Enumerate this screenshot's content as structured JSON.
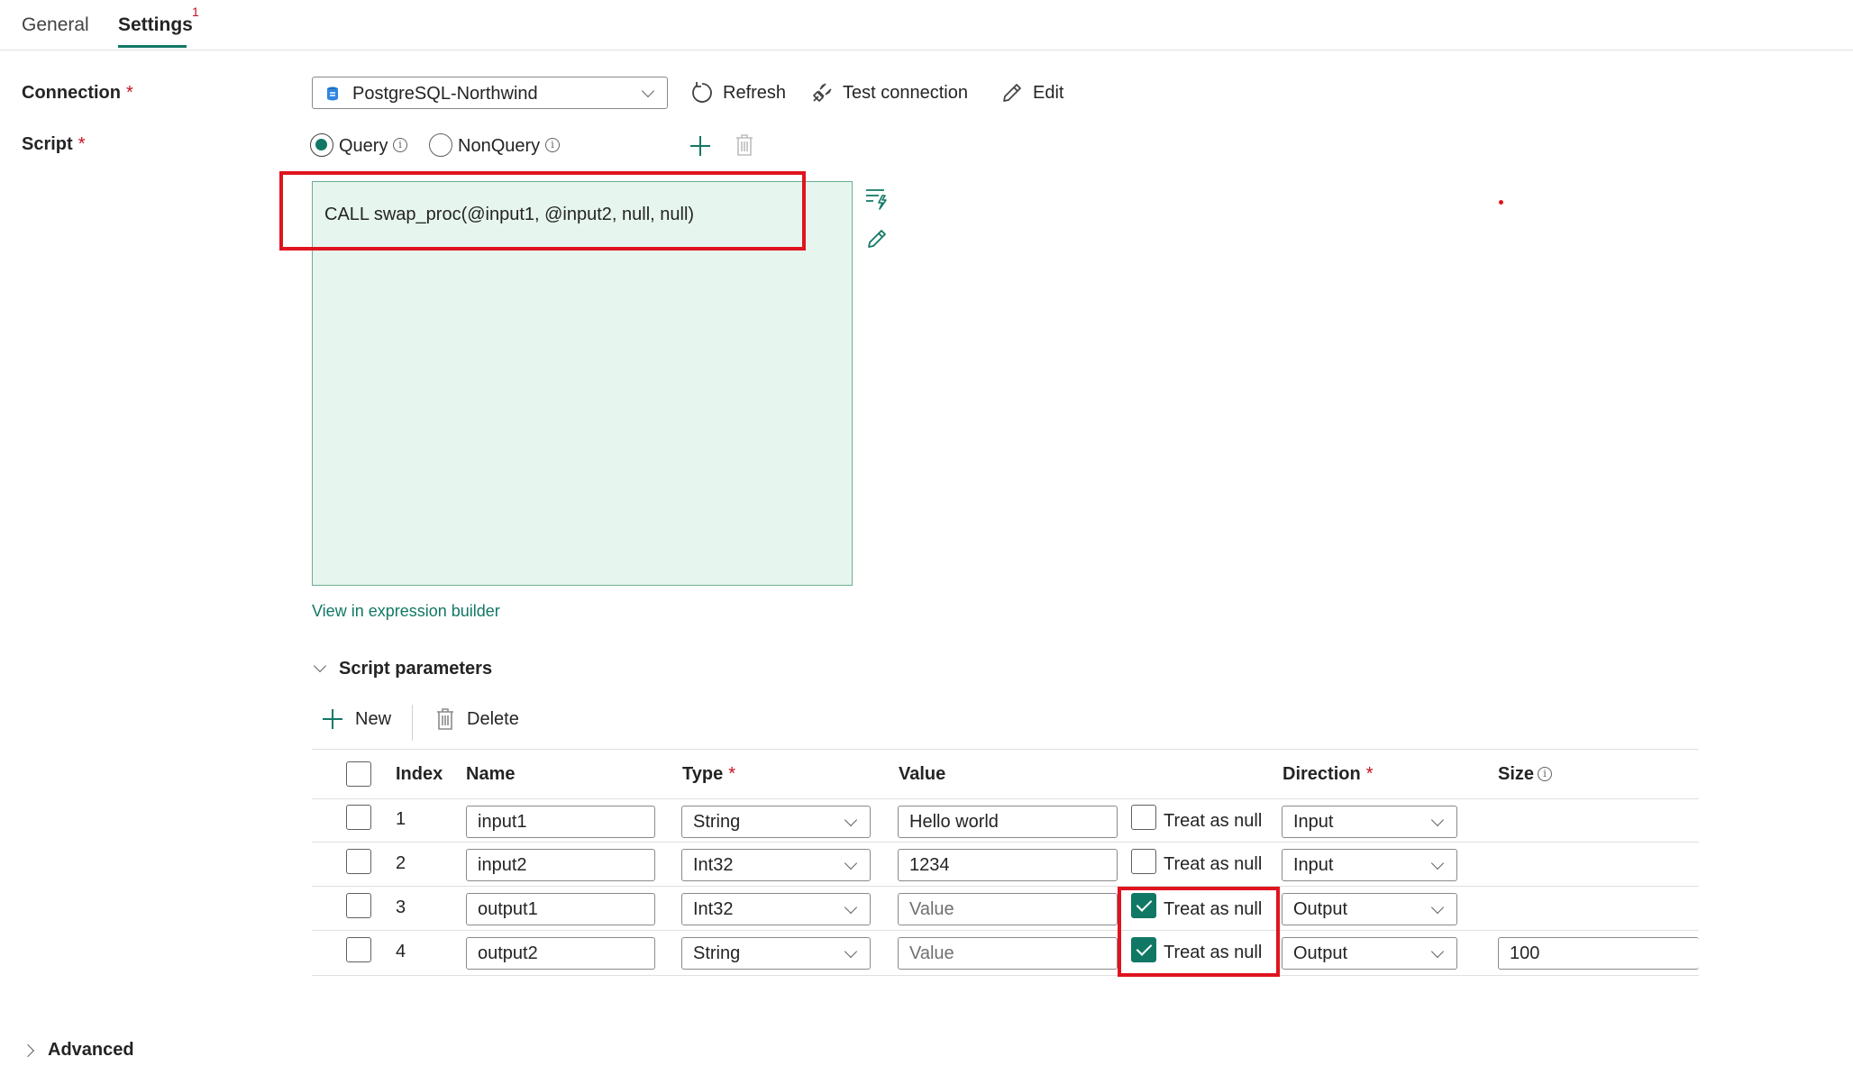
{
  "tabs": [
    {
      "label": "General"
    },
    {
      "label": "Settings",
      "badge": "1"
    }
  ],
  "connection": {
    "label": "Connection",
    "required_mark": "*",
    "selected": "PostgreSQL-Northwind",
    "refresh_label": "Refresh",
    "test_label": "Test connection",
    "edit_label": "Edit"
  },
  "script": {
    "label": "Script",
    "required_mark": "*",
    "query_label": "Query",
    "nonquery_label": "NonQuery",
    "selected": "Query",
    "text": "CALL swap_proc(@input1, @input2, null, null)",
    "expression_link": "View in expression builder"
  },
  "params": {
    "section_label": "Script parameters",
    "new_label": "New",
    "delete_label": "Delete",
    "headers": {
      "index": "Index",
      "name": "Name",
      "type": "Type",
      "value": "Value",
      "direction": "Direction",
      "size": "Size",
      "required_mark": "*"
    },
    "treat_null_label": "Treat as null",
    "value_placeholder": "Value",
    "rows": [
      {
        "index": "1",
        "name": "input1",
        "type": "String",
        "value": "Hello world",
        "treat_null": false,
        "direction": "Input",
        "size": ""
      },
      {
        "index": "2",
        "name": "input2",
        "type": "Int32",
        "value": "1234",
        "treat_null": false,
        "direction": "Input",
        "size": ""
      },
      {
        "index": "3",
        "name": "output1",
        "type": "Int32",
        "value": "",
        "treat_null": true,
        "direction": "Output",
        "size": ""
      },
      {
        "index": "4",
        "name": "output2",
        "type": "String",
        "value": "",
        "treat_null": true,
        "direction": "Output",
        "size": "100"
      }
    ]
  },
  "advanced": {
    "label": "Advanced"
  },
  "colors": {
    "accent": "#117865",
    "highlight": "#e0141e",
    "editor_bg": "#e6f6ee"
  }
}
